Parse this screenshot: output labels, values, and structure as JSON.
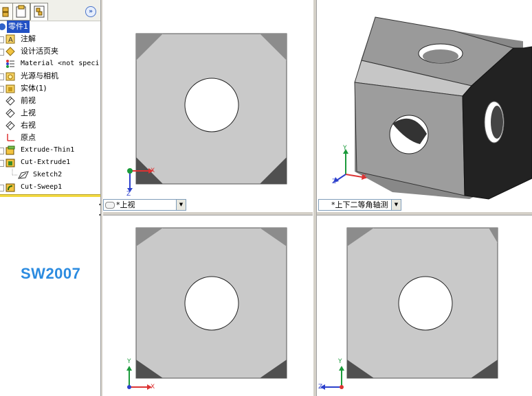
{
  "tree": {
    "root": "零件1",
    "items": [
      {
        "label": "注解",
        "icon": "annotation-icon"
      },
      {
        "label": "设计活页夹",
        "icon": "design-binder-icon"
      },
      {
        "label": "Material <not speci",
        "icon": "material-icon"
      },
      {
        "label": "光源与相机",
        "icon": "lights-cameras-icon"
      },
      {
        "label": "实体(1)",
        "icon": "solid-bodies-icon"
      },
      {
        "label": "前视",
        "icon": "plane-icon"
      },
      {
        "label": "上视",
        "icon": "plane-icon"
      },
      {
        "label": "右视",
        "icon": "plane-icon"
      },
      {
        "label": "原点",
        "icon": "origin-icon"
      },
      {
        "label": "Extrude-Thin1",
        "icon": "extrude-feature-icon"
      },
      {
        "label": "Cut-Extrude1",
        "icon": "cut-extrude-feature-icon"
      },
      {
        "label": "Sketch2",
        "icon": "sketch-icon"
      },
      {
        "label": "Cut-Sweep1",
        "icon": "cut-sweep-feature-icon"
      }
    ]
  },
  "logo": "SW2007",
  "views": {
    "top_left": "*上视",
    "top_right": "*上下二等角轴测"
  },
  "axes": {
    "x": "X",
    "y": "Y",
    "z": "Z"
  },
  "colors": {
    "selection": "#2251c4",
    "logo": "#2b8be0",
    "face": "#c8c8c8",
    "x_axis": "#d33",
    "y_axis": "#1a9a3a",
    "z_axis": "#2b3fcc"
  }
}
